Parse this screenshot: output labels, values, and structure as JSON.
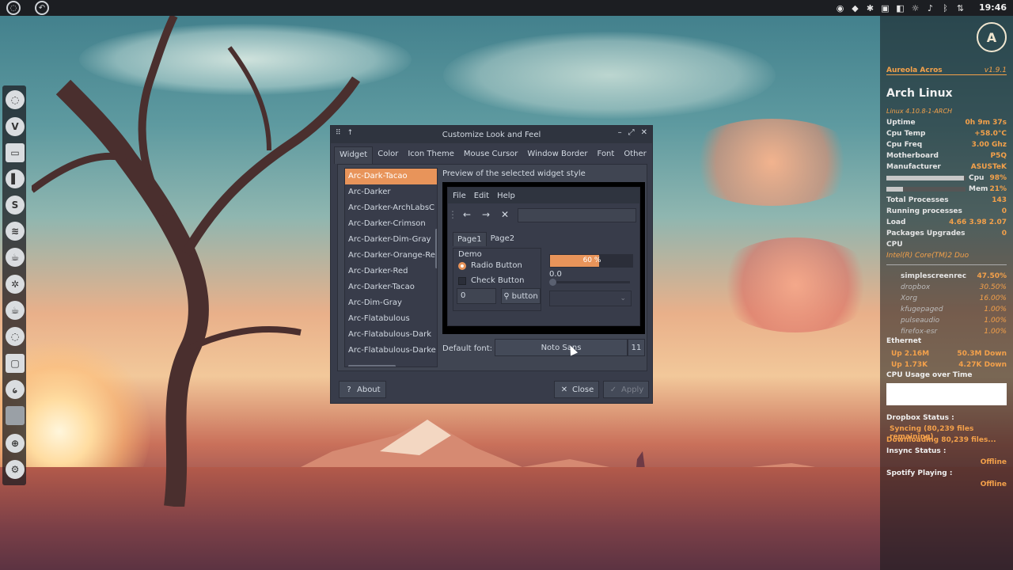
{
  "top_panel": {
    "clock": "19:46",
    "tray_icons": [
      "camera-icon",
      "dropbox-icon",
      "gear-icon",
      "display-icon",
      "volume-icon",
      "brightness-icon",
      "speaker-icon",
      "bluetooth-icon",
      "network-icon"
    ]
  },
  "dock": {
    "items": [
      "app-icon-1",
      "vivaldi-icon",
      "files-icon",
      "terminal-icon",
      "skype-icon",
      "spotify-icon",
      "teapot-icon",
      "settings-icon",
      "teapot2-icon",
      "app-icon-2",
      "monitor-icon",
      "swirl-icon",
      "blank-icon",
      "pivot-icon",
      "tool-icon"
    ]
  },
  "conky": {
    "header_left": "Aureola Acros",
    "header_right": "v1.9.1",
    "distro": "Arch Linux",
    "kernel": "Linux 4.10.8-1-ARCH",
    "rows": [
      {
        "k": "Uptime",
        "v": "0h 9m 37s"
      },
      {
        "k": "Cpu Temp",
        "v": "+58.0°C"
      },
      {
        "k": "Cpu Freq",
        "v": "3.00 Ghz"
      },
      {
        "k": "Motherboard",
        "v": "P5Q"
      },
      {
        "k": "Manufacturer",
        "v": "ASUSTeK"
      }
    ],
    "cpu_label": "Cpu",
    "cpu_value": "98%",
    "mem_label": "Mem",
    "mem_value": "21%",
    "cpu_usage": 0.98,
    "mem_usage": 0.21,
    "rows2": [
      {
        "k": "Total Processes",
        "v": "143"
      },
      {
        "k": "Running processes",
        "v": "0"
      },
      {
        "k": "Load",
        "v": "4.66 3.98 2.07"
      },
      {
        "k": "Packages Upgrades",
        "v": "0"
      }
    ],
    "cpu_title": "CPU",
    "cpu_model": "Intel(R) Core(TM)2 Duo",
    "processes": [
      {
        "name": "simplescreenrec",
        "pct": "47.50%"
      },
      {
        "name": "dropbox",
        "pct": "30.50%"
      },
      {
        "name": "Xorg",
        "pct": "16.00%"
      },
      {
        "name": "kfugepaged",
        "pct": "1.00%"
      },
      {
        "name": "pulseaudio",
        "pct": "1.00%"
      },
      {
        "name": "firefox-esr",
        "pct": "1.00%"
      }
    ],
    "ethernet": "Ethernet",
    "net": [
      {
        "k": "Up 2.16M",
        "v": "50.3M Down"
      },
      {
        "k": "Up 1.73K",
        "v": "4.27K Down"
      }
    ],
    "graph_title": "CPU Usage over Time",
    "dropbox_status": "Dropbox Status :",
    "dropbox_line1": "Syncing (80,239 files remaining)",
    "dropbox_line2": "Downloading 80,239 files...",
    "insync_status": "Insync Status :",
    "insync_value": "Offline",
    "spotify_playing": "Spotify Playing :",
    "spotify_value": "Offline"
  },
  "dialog": {
    "title": "Customize Look and Feel",
    "tabs": [
      "Widget",
      "Color",
      "Icon Theme",
      "Mouse Cursor",
      "Window Border",
      "Font",
      "Other"
    ],
    "themes": [
      "Arc-Dark-Tacao",
      "Arc-Darker",
      "Arc-Darker-ArchLabsC",
      "Arc-Darker-Crimson",
      "Arc-Darker-Dim-Gray",
      "Arc-Darker-Orange-Re",
      "Arc-Darker-Red",
      "Arc-Darker-Tacao",
      "Arc-Dim-Gray",
      "Arc-Flatabulous",
      "Arc-Flatabulous-Dark",
      "Arc-Flatabulous-Darke"
    ],
    "preview_label": "Preview of the selected widget style",
    "preview": {
      "menu": [
        "File",
        "Edit",
        "Help"
      ],
      "tabs": [
        "Page1",
        "Page2"
      ],
      "frame_label": "Demo",
      "radio_label": "Radio Button",
      "check_label": "Check Button",
      "spin_value": "0",
      "button_label": "button",
      "progress_text": "60 %",
      "progress": 0.6,
      "scale_value": "0.0"
    },
    "default_font_label": "Default font:",
    "font_name": "Noto Sans",
    "font_size": "11",
    "about_label": "About",
    "close_label": "Close",
    "apply_label": "Apply"
  }
}
